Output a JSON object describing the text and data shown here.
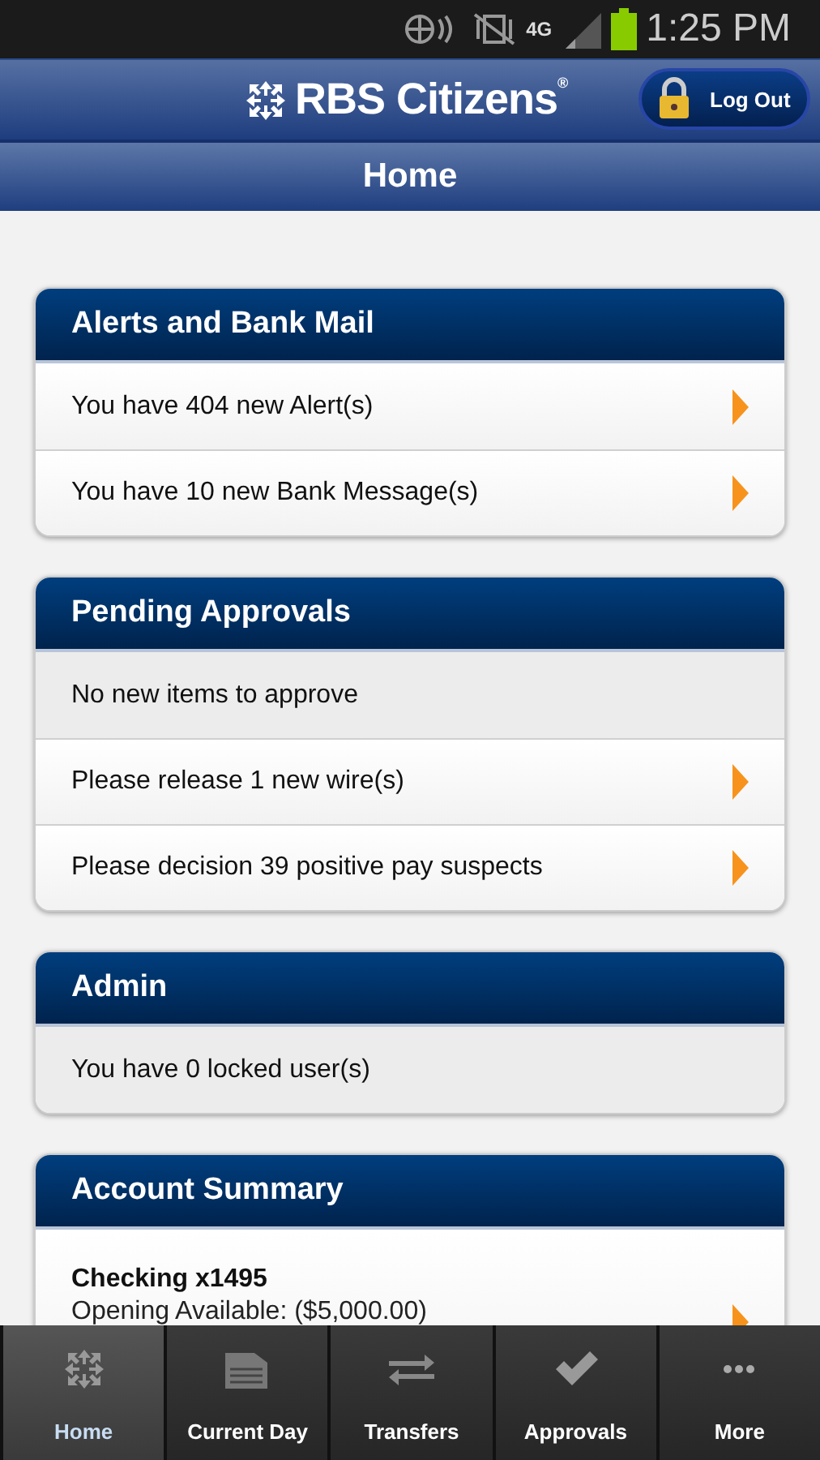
{
  "status_bar": {
    "network_type": "4G",
    "time": "1:25 PM"
  },
  "header": {
    "logo": "RBS Citizens$^{®}$",
    "logout_button": "Log Out"
  },
  "title_bar": {
    "title": "Home"
  },
  "cards": [
    {
      "title": "Alerts and Bank Mail",
      "rows": [
        {
          "kind": "link",
          "text": "You have 404 new Alert(s)"
        },
        {
          "kind": "link",
          "text": "You have 10 new Bank Message(s)"
        }
      ]
    },
    {
      "title": "Pending Approvals",
      "rows": [
        {
          "kind": "info",
          "text": "No new items to approve"
        },
        {
          "kind": "link",
          "text": "Please release 1 new wire(s)"
        },
        {
          "kind": "link",
          "text": "Please decision 39 positive pay suspects"
        }
      ]
    },
    {
      "title": "Admin",
      "rows": [
        {
          "kind": "info",
          "text": "You have 0 locked user(s)"
        }
      ]
    },
    {
      "title": "Account Summary",
      "rows": [
        {
          "kind": "account",
          "text": "Checking x1495",
          "detail": "Opening Available: ($5,000.00)"
        }
      ]
    }
  ],
  "nav": [
    {
      "kind": "home",
      "label": "Home",
      "selected": true
    },
    {
      "kind": "document",
      "label": "Current Day",
      "selected": false
    },
    {
      "kind": "transfer",
      "label": "Transfers",
      "selected": false
    },
    {
      "kind": "check",
      "label": "Approvals",
      "selected": false
    },
    {
      "kind": "more",
      "label": "More",
      "selected": false
    }
  ]
}
